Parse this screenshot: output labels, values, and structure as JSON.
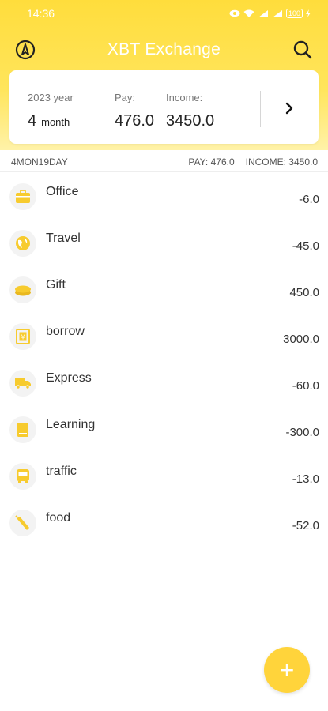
{
  "status_bar": {
    "time": "14:36",
    "battery": "100"
  },
  "app_bar": {
    "title": "XBT Exchange",
    "left_icon": "compass-icon",
    "right_icon": "search-icon"
  },
  "summary": {
    "year": "2023 year",
    "month_num": "4",
    "month_unit": "month",
    "pay_label": "Pay:",
    "pay_value": "476.0",
    "income_label": "Income:",
    "income_value": "3450.0"
  },
  "day": {
    "label": "4MON19DAY",
    "pay": "PAY: 476.0",
    "income": "INCOME: 3450.0"
  },
  "records": [
    {
      "name": "Office",
      "amount": "-6.0",
      "icon": "briefcase-icon"
    },
    {
      "name": "Travel",
      "amount": "-45.0",
      "icon": "globe-icon"
    },
    {
      "name": "Gift",
      "amount": "450.0",
      "icon": "coin-icon"
    },
    {
      "name": "borrow",
      "amount": "3000.0",
      "icon": "yen-note-icon"
    },
    {
      "name": "Express",
      "amount": "-60.0",
      "icon": "truck-icon"
    },
    {
      "name": "Learning",
      "amount": "-300.0",
      "icon": "book-icon"
    },
    {
      "name": "traffic",
      "amount": "-13.0",
      "icon": "bus-icon"
    },
    {
      "name": "food",
      "amount": "-52.0",
      "icon": "food-icon"
    }
  ],
  "fab": {
    "label": "+"
  },
  "colors": {
    "accent": "#FFD43B",
    "header": "#FFDD3C",
    "icon": "#F7CB2E"
  }
}
